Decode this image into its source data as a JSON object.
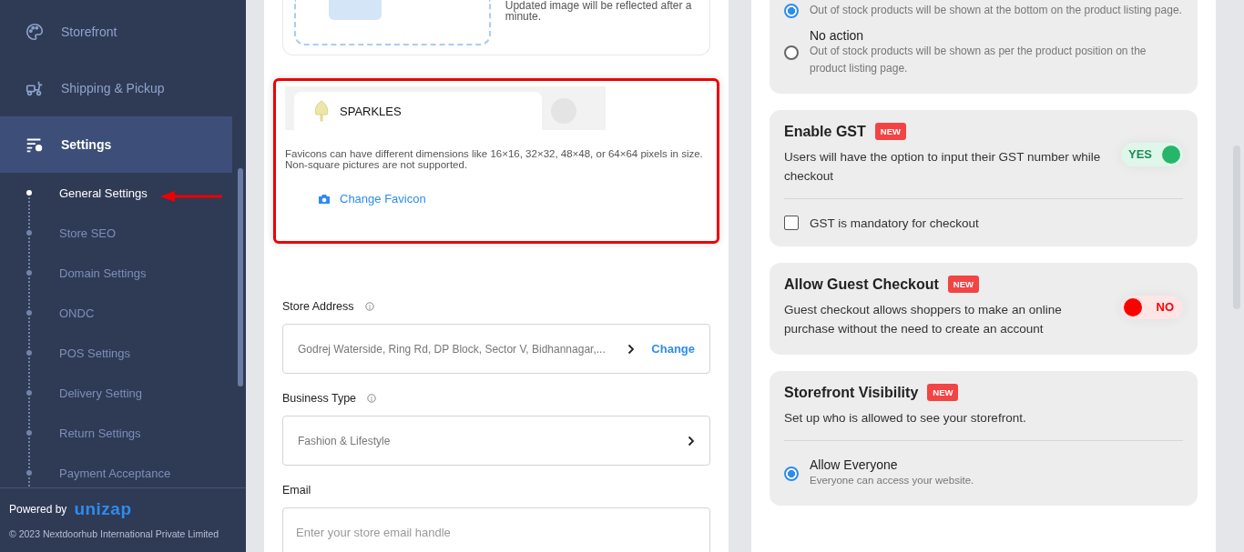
{
  "sidebar": {
    "nav": [
      {
        "label": "Storefront",
        "selected": false
      },
      {
        "label": "Shipping & Pickup",
        "selected": false
      },
      {
        "label": "Settings",
        "selected": true
      }
    ],
    "sub_items": [
      {
        "label": "General Settings",
        "selected": true
      },
      {
        "label": "Store SEO",
        "selected": false
      },
      {
        "label": "Domain Settings",
        "selected": false
      },
      {
        "label": "ONDC",
        "selected": false
      },
      {
        "label": "POS Settings",
        "selected": false
      },
      {
        "label": "Delivery Setting",
        "selected": false
      },
      {
        "label": "Return Settings",
        "selected": false
      },
      {
        "label": "Payment Acceptance",
        "selected": false
      }
    ],
    "footer": {
      "powered_by": "Powered by",
      "brand": "unizap",
      "copyright": "© 2023 Nextdoorhub International Private Limited"
    }
  },
  "annotations": {
    "highlight_box": true,
    "arrow": true
  },
  "middle": {
    "image_note": "Updated image will be reflected after a minute.",
    "favicon": {
      "tab_title": "SPARKLES",
      "description": "Favicons can have different dimensions like 16×16, 32×32, 48×48, or 64×64 pixels in size. Non-square pictures are not supported.",
      "action": "Change Favicon"
    },
    "fields": [
      {
        "label": "Store Address",
        "help": true,
        "kind": "address",
        "value": "Godrej Waterside, Ring Rd, DP Block, Sector V, Bidhannagar,...",
        "action": "Change"
      },
      {
        "label": "Business Type",
        "help": true,
        "kind": "select",
        "value": "Fashion & Lifestyle"
      },
      {
        "label": "Email",
        "help": false,
        "kind": "input",
        "placeholder": "Enter your store email handle"
      }
    ]
  },
  "right": {
    "stock_options": [
      {
        "description": "Out of stock products will be shown at the bottom on the product listing page.",
        "selected": true
      },
      {
        "title": "No action",
        "description": "Out of stock products will be shown as per the product position on the product listing page.",
        "selected": false
      }
    ],
    "cards": [
      {
        "title": "Enable GST",
        "badge": "NEW",
        "description": "Users will have the option to input their GST number while checkout",
        "toggle": {
          "on": true,
          "label": "YES"
        },
        "checkbox": {
          "label": "GST is mandatory for checkout",
          "checked": false
        }
      },
      {
        "title": "Allow Guest Checkout",
        "badge": "NEW",
        "description": "Guest checkout allows shoppers to make an online purchase without the need to create an account",
        "toggle": {
          "on": false,
          "label": "NO"
        }
      },
      {
        "title": "Storefront Visibility",
        "badge": "NEW",
        "description": "Set up who is allowed to see your storefront.",
        "options": [
          {
            "title": "Allow Everyone",
            "description": "Everyone can access your website.",
            "selected": true
          }
        ]
      }
    ]
  }
}
